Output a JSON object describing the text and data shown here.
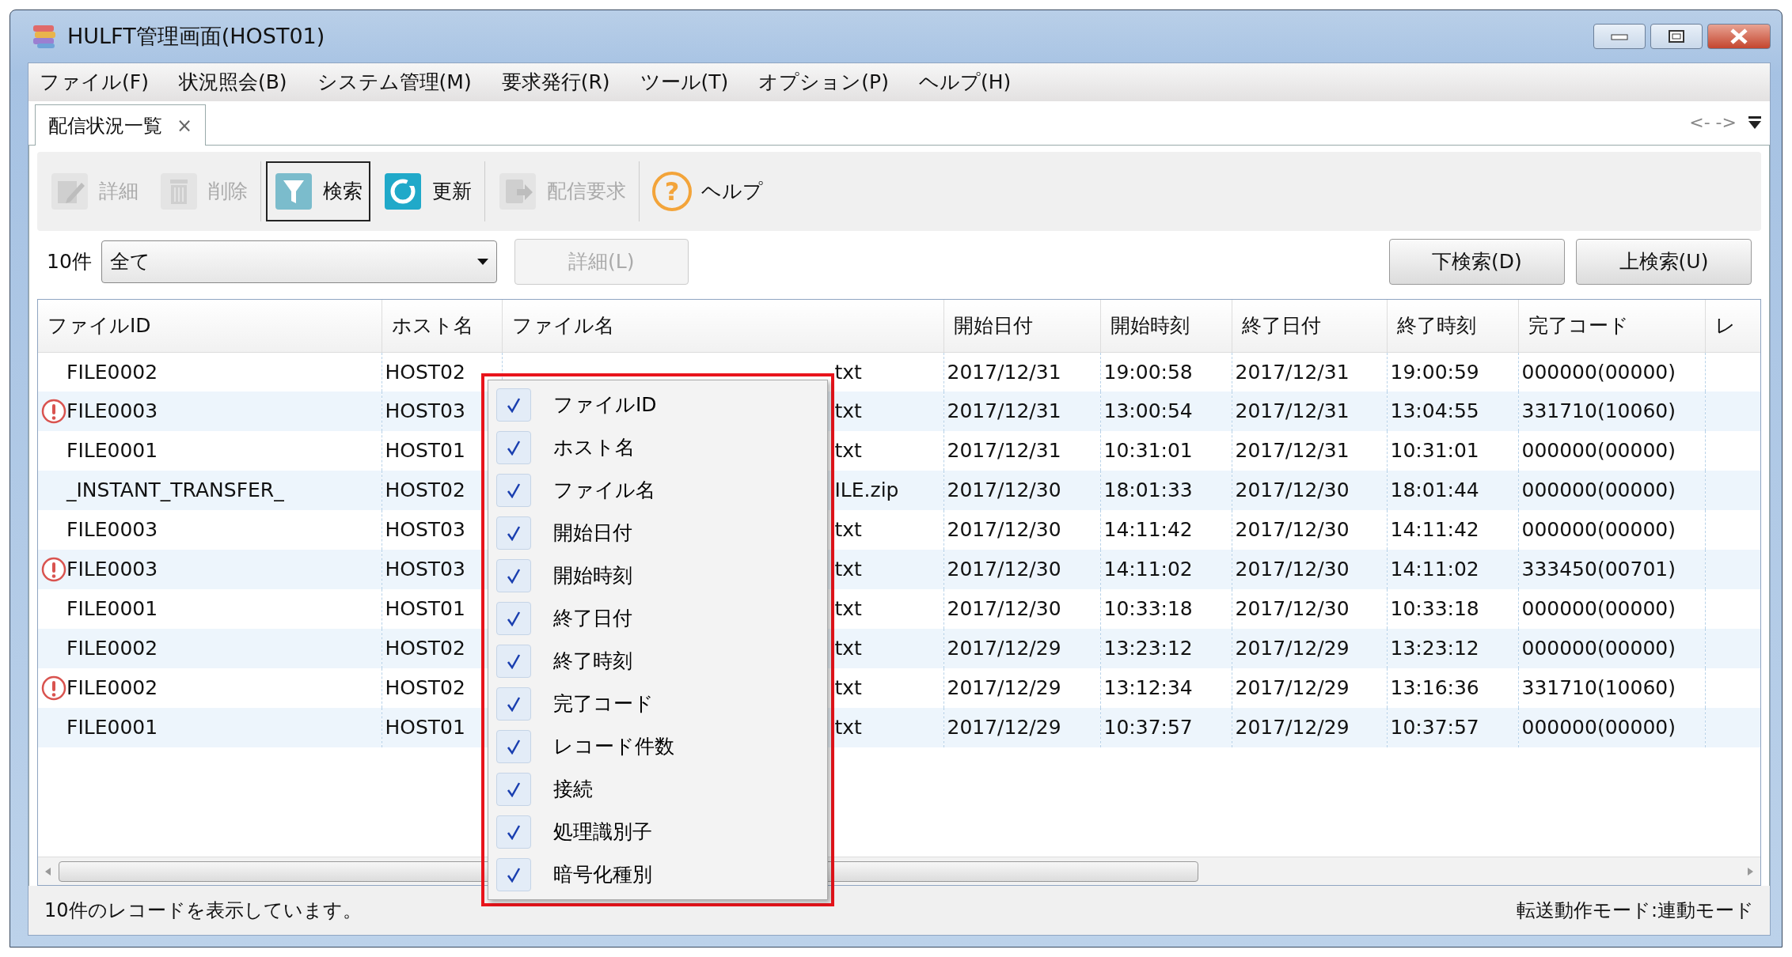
{
  "window": {
    "title": "HULFT管理画面(HOST01)"
  },
  "menu_bar": [
    "ファイル(F)",
    "状況照会(B)",
    "システム管理(M)",
    "要求発行(R)",
    "ツール(T)",
    "オプション(P)",
    "ヘルプ(H)"
  ],
  "tabs": [
    {
      "label": "配信状況一覧",
      "selected": true,
      "close": "×"
    }
  ],
  "tab_nav": "<- ->",
  "toolbar": [
    {
      "kind": "edit",
      "label": "詳細",
      "disabled": true,
      "selected": false
    },
    {
      "kind": "delete",
      "label": "削除",
      "disabled": true,
      "selected": false
    },
    {
      "kind": "filter",
      "label": "検索",
      "disabled": false,
      "selected": true
    },
    {
      "kind": "refresh",
      "label": "更新",
      "disabled": false,
      "selected": false
    },
    {
      "kind": "send",
      "label": "配信要求",
      "disabled": true,
      "selected": false
    },
    {
      "kind": "help",
      "label": "ヘルプ",
      "disabled": false,
      "selected": false,
      "glyph": "?"
    }
  ],
  "filter": {
    "count": "10件",
    "select_value": "全て",
    "detail_button": {
      "label": "詳細(L)",
      "disabled": true
    },
    "search_down": "下検索(D)",
    "search_up": "上検索(U)"
  },
  "table": {
    "columns": [
      "ファイルID",
      "ホスト名",
      "ファイル名",
      "開始日付",
      "開始時刻",
      "終了日付",
      "終了時刻",
      "完了コード",
      "レ"
    ],
    "rows": [
      {
        "warning": false,
        "cells": [
          "FILE0002",
          "HOST02",
          "txt",
          "2017/12/31",
          "19:00:58",
          "2017/12/31",
          "19:00:59",
          "000000(00000)"
        ]
      },
      {
        "warning": true,
        "cells": [
          "FILE0003",
          "HOST03",
          "txt",
          "2017/12/31",
          "13:00:54",
          "2017/12/31",
          "13:04:55",
          "331710(10060)"
        ]
      },
      {
        "warning": false,
        "cells": [
          "FILE0001",
          "HOST01",
          "txt",
          "2017/12/31",
          "10:31:01",
          "2017/12/31",
          "10:31:01",
          "000000(00000)"
        ]
      },
      {
        "warning": false,
        "cells": [
          "_INSTANT_TRANSFER_",
          "HOST02",
          "ILE.zip",
          "2017/12/30",
          "18:01:33",
          "2017/12/30",
          "18:01:44",
          "000000(00000)"
        ]
      },
      {
        "warning": false,
        "cells": [
          "FILE0003",
          "HOST03",
          "txt",
          "2017/12/30",
          "14:11:42",
          "2017/12/30",
          "14:11:42",
          "000000(00000)"
        ]
      },
      {
        "warning": true,
        "cells": [
          "FILE0003",
          "HOST03",
          "txt",
          "2017/12/30",
          "14:11:02",
          "2017/12/30",
          "14:11:02",
          "333450(00701)"
        ]
      },
      {
        "warning": false,
        "cells": [
          "FILE0001",
          "HOST01",
          "txt",
          "2017/12/30",
          "10:33:18",
          "2017/12/30",
          "10:33:18",
          "000000(00000)"
        ]
      },
      {
        "warning": false,
        "cells": [
          "FILE0002",
          "HOST02",
          "txt",
          "2017/12/29",
          "13:23:12",
          "2017/12/29",
          "13:23:12",
          "000000(00000)"
        ]
      },
      {
        "warning": true,
        "cells": [
          "FILE0002",
          "HOST02",
          "txt",
          "2017/12/29",
          "13:12:34",
          "2017/12/29",
          "13:16:36",
          "331710(10060)"
        ]
      },
      {
        "warning": false,
        "cells": [
          "FILE0001",
          "HOST01",
          "txt",
          "2017/12/29",
          "10:37:57",
          "2017/12/29",
          "10:37:57",
          "000000(00000)"
        ]
      }
    ]
  },
  "column_menu": {
    "highlighted": true,
    "items": [
      {
        "label": "ファイルID",
        "checked": true
      },
      {
        "label": "ホスト名",
        "checked": true
      },
      {
        "label": "ファイル名",
        "checked": true
      },
      {
        "label": "開始日付",
        "checked": true
      },
      {
        "label": "開始時刻",
        "checked": true
      },
      {
        "label": "終了日付",
        "checked": true
      },
      {
        "label": "終了時刻",
        "checked": true
      },
      {
        "label": "完了コード",
        "checked": true
      },
      {
        "label": "レコード件数",
        "checked": true
      },
      {
        "label": "接続",
        "checked": true
      },
      {
        "label": "処理識別子",
        "checked": true
      },
      {
        "label": "暗号化種別",
        "checked": true
      }
    ]
  },
  "status_bar": {
    "left": "10件のレコードを表示しています。",
    "right": "転送動作モード:連動モード"
  }
}
